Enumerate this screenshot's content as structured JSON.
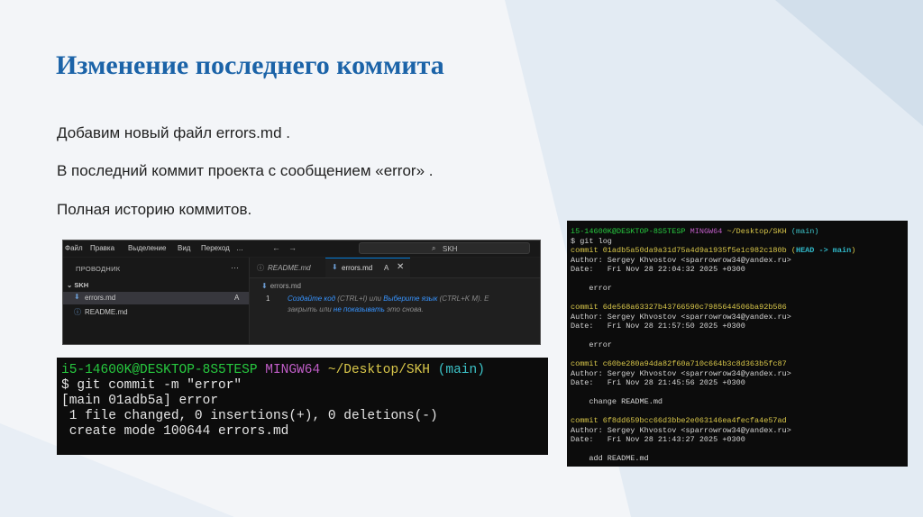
{
  "slide": {
    "title": "Изменение последнего коммита",
    "paragraphs": [
      "Добавим новый файл errors.md .",
      "В последний коммит проекта с сообщением «error» .",
      "Полная историю коммитов."
    ]
  },
  "colors": {
    "title": "#1b63a8",
    "terminal_bg": "#0c0c0c",
    "vscode_bg": "#1f1f1f",
    "accent": "#0078d4"
  },
  "vscode": {
    "menu": [
      "Файл",
      "Правка",
      "Выделение",
      "Вид",
      "Переход",
      "…"
    ],
    "nav_back": "←",
    "nav_forward": "→",
    "search": "SKH",
    "sidebar": {
      "header": "ПРОВОДНИК",
      "more": "···",
      "folder": "SKH",
      "files": [
        {
          "name": "errors.md",
          "badge": "A"
        },
        {
          "name": "README.md",
          "badge": ""
        }
      ]
    },
    "tabs": [
      {
        "label": "README.md",
        "badge": ""
      },
      {
        "label": "errors.md",
        "badge": "A",
        "close": "✕"
      }
    ],
    "breadcrumb": "errors.md",
    "line_number": "1",
    "hint": {
      "l1_a": "Создайте код",
      "l1_b": " (CTRL+I) или ",
      "l1_c": "Выберите язык",
      "l1_d": " (CTRL+K M). Е",
      "l2_a": "закрыть или ",
      "l2_b": "не показывать",
      "l2_c": " это снова."
    }
  },
  "terminal1": {
    "prompt_user": "i5-14600K@DESKTOP-8S5TESP",
    "prompt_env": "MINGW64",
    "prompt_path": "~/Desktop/SKH",
    "prompt_branch": "(main)",
    "command": "$ git commit -m \"error\"",
    "out1": "[main 01adb5a] error",
    "out2": " 1 file changed, 0 insertions(+), 0 deletions(-)",
    "out3": " create mode 100644 errors.md"
  },
  "terminal2": {
    "prompt_user": "i5-14600K@DESKTOP-8S5TESP",
    "prompt_env": "MINGW64",
    "prompt_path": "~/Desktop/SKH",
    "prompt_branch": "(main)",
    "command": "$ git log",
    "head_open": "(",
    "head_label": "HEAD -> main",
    "head_close": ")",
    "commits": [
      {
        "hash": "commit 01adb5a50da9a31d75a4d9a1935f5e1c982c180b",
        "author": "Author: Sergey Khvostov <sparrowrow34@yandex.ru>",
        "date": "Date:   Fri Nov 28 22:04:32 2025 +0300",
        "message": "    error"
      },
      {
        "hash": "commit 6de568a63327b43766590c7985644506ba92b586",
        "author": "Author: Sergey Khvostov <sparrowrow34@yandex.ru>",
        "date": "Date:   Fri Nov 28 21:57:50 2025 +0300",
        "message": "    error"
      },
      {
        "hash": "commit c60be280a94da82f60a710c664b3c8d363b5fc87",
        "author": "Author: Sergey Khvostov <sparrowrow34@yandex.ru>",
        "date": "Date:   Fri Nov 28 21:45:56 2025 +0300",
        "message": "    change README.md"
      },
      {
        "hash": "commit 6f8dd659bcc66d3bbe2e063146ea4fecfa4e57ad",
        "author": "Author: Sergey Khvostov <sparrowrow34@yandex.ru>",
        "date": "Date:   Fri Nov 28 21:43:27 2025 +0300",
        "message": "    add README.md"
      }
    ]
  }
}
